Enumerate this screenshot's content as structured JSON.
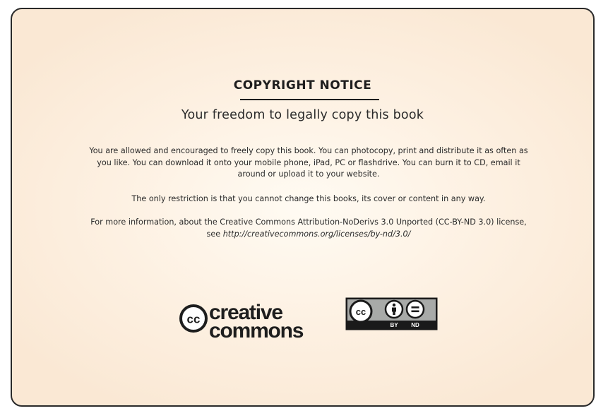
{
  "notice": {
    "title": "COPYRIGHT NOTICE",
    "subtitle": "Your freedom to legally copy this book",
    "paragraph1": "You are allowed and encouraged to freely copy this book. You can photocopy, print and distribute it as often as you like. You can download it onto your mobile phone, iPad, PC or flashdrive. You can burn it to CD, email it around or upload it to your website.",
    "paragraph2": "The only restriction is that you cannot change this books, its cover or content in any way.",
    "paragraph3_prefix": "For more information, about the Creative Commons Attribution-NoDerivs 3.0 Unported (CC-BY-ND 3.0) license, see ",
    "paragraph3_url": "http://creativecommons.org/licenses/by-nd/3.0/"
  },
  "logos": {
    "cc_logo": {
      "symbol": "cc",
      "word1": "creative",
      "word2": "commons"
    },
    "license_badge": {
      "symbol": "cc",
      "by_label": "BY",
      "nd_label": "ND",
      "icons": [
        "cc-icon",
        "attribution-icon",
        "no-derivatives-icon"
      ]
    }
  },
  "colors": {
    "background": "#fdf0e1",
    "border": "#2a2a2a",
    "text": "#2a2a2a",
    "badge_dark": "#1a1a1a",
    "badge_light": "#a8aaa8"
  }
}
